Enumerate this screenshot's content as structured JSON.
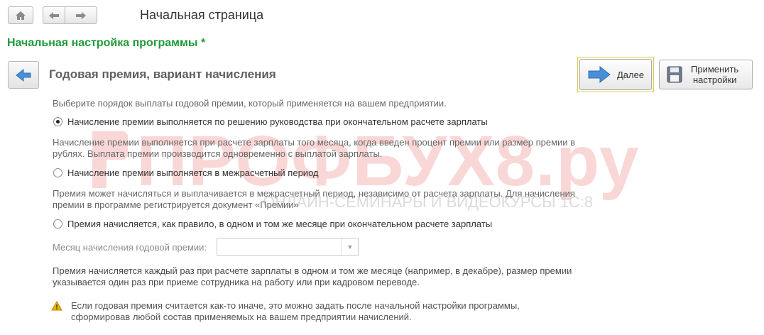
{
  "header": {
    "title": "Начальная страница"
  },
  "section_title": "Начальная настройка программы *",
  "step": {
    "title": "Годовая премия,  вариант начисления"
  },
  "buttons": {
    "next_label": "Далее",
    "apply_line1": "Применить",
    "apply_line2": "настройки"
  },
  "prompt": "Выберите порядок выплаты годовой премии, который применяется на вашем предприятии.",
  "options": [
    {
      "label": "Начисление премии выполняется по решению руководства при окончательном расчете зарплаты",
      "checked": true,
      "desc_line1": "Начисление премии выполняется при расчете зарплаты того месяца, когда введен процент премии или размер премии в",
      "desc_line2": "рублях. Выплата премии производится одновременно с выплатой зарплаты."
    },
    {
      "label": "Начисление премии выполняется в межрасчетный период",
      "checked": false,
      "desc_line1": "Премия может начисляться и выплачивается в межрасчетный период, независимо от расчета зарплаты. Для начисления",
      "desc_line2": "премии в программе регистрируется документ «Премии»"
    },
    {
      "label": "Премия начисляется, как правило, в одном и том же месяце при окончательном расчете зарплаты",
      "checked": false,
      "desc_line1": "Премия начисляется каждый раз при расчете зарплаты в одном и том же месяце (например, в декабре), размер премии",
      "desc_line2": "указывается один раз при приеме сотрудника на работу или при кадровом переводе."
    }
  ],
  "month_field": {
    "label": "Месяц начисления годовой премии:",
    "value": ""
  },
  "warning": {
    "line1": "Если годовая премия считается как-то иначе, это можно задать после начальной настройки программы,",
    "line2": "сформировав любой состав применяемых на вашем предприятии начислений."
  },
  "watermark": {
    "main": "ПРОФБУХ8.ру",
    "sub": "ОНЛАЙН-СЕМИНАРЫ И ВИДЕОКУРСЫ 1С:8"
  },
  "colors": {
    "section_title": "#1f9a3a",
    "arrow": "#4a8fd6",
    "warning": "#e8b400",
    "watermark": "#f6b7b7"
  }
}
